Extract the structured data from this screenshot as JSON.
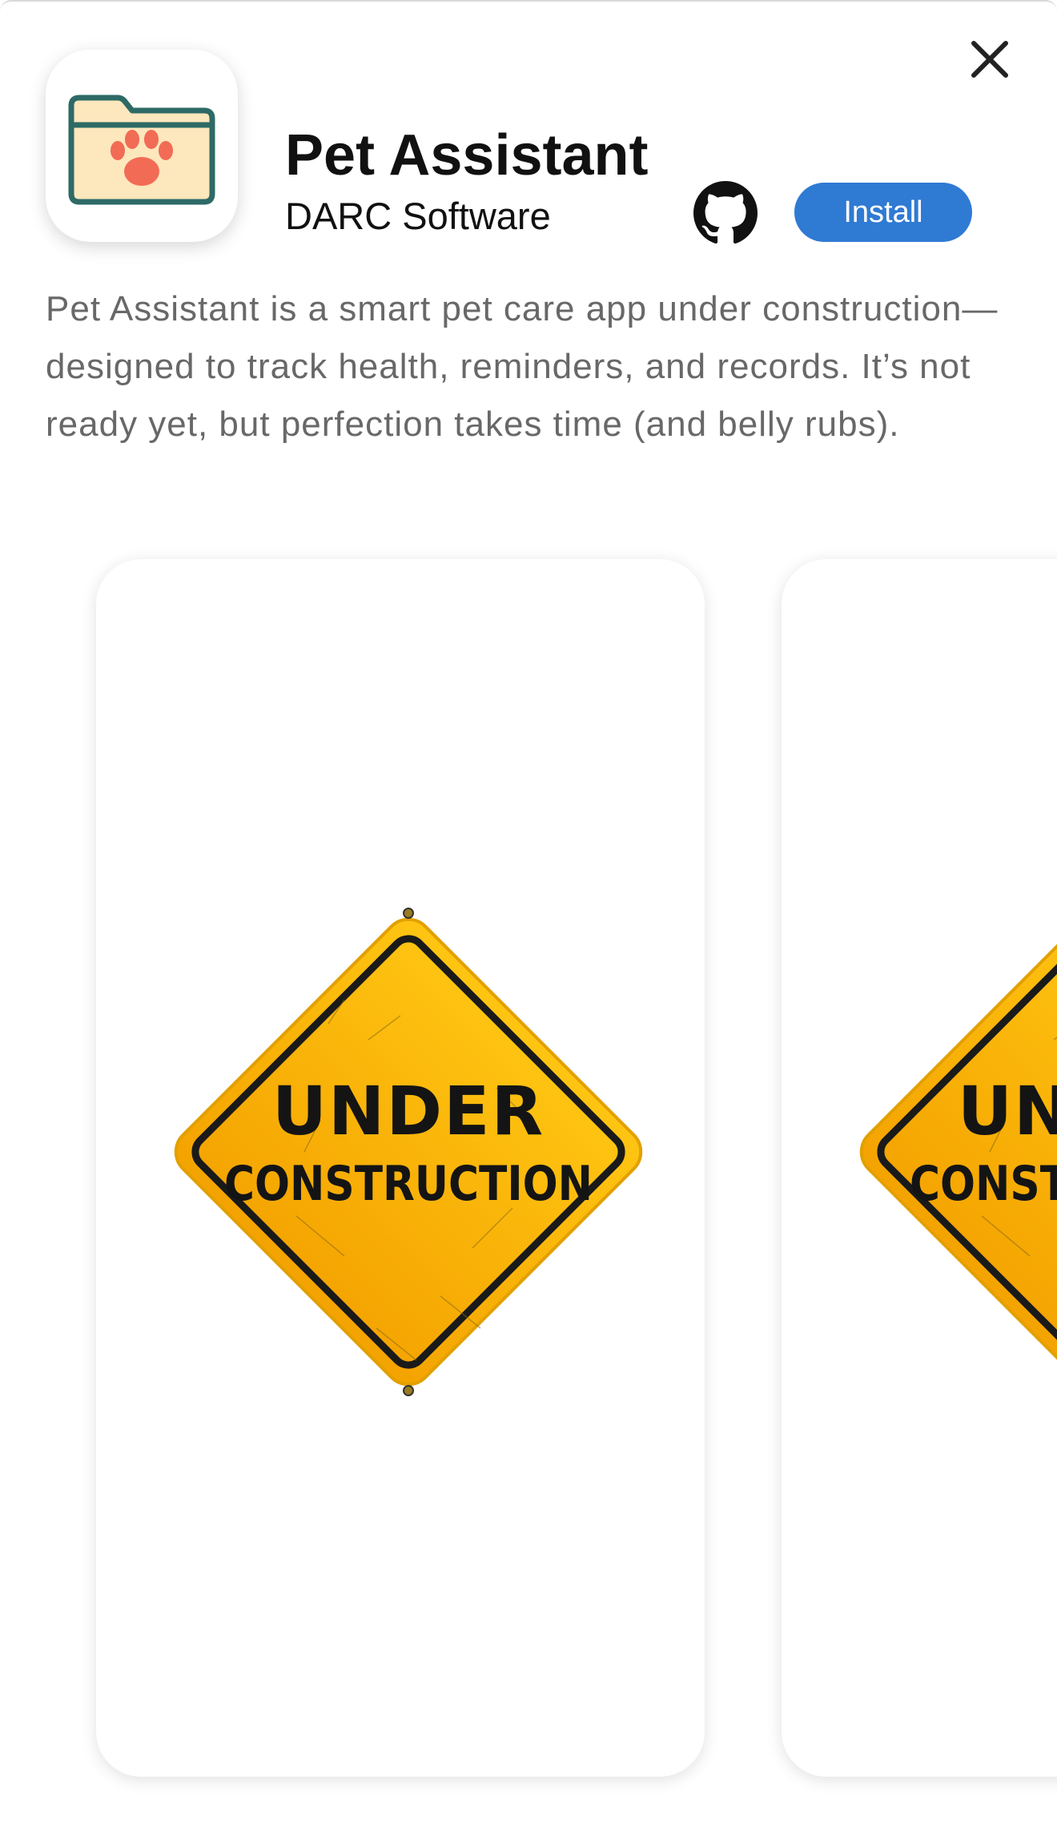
{
  "app": {
    "title": "Pet Assistant",
    "developer": "DARC Software",
    "install_label": "Install",
    "description": "Pet Assistant is a smart pet care app under construction—designed to track health, reminders, and records. It’s not ready yet, but perfection takes time (and belly rubs)."
  },
  "icons": {
    "close": "close-icon",
    "app_icon": "folder-paw-icon",
    "github": "github-icon"
  },
  "screenshots": [
    {
      "sign_line1": "UNDER",
      "sign_line2": "CONSTRUCTION"
    },
    {
      "sign_line1": "UNDER",
      "sign_line2": "CONSTRUCTION"
    }
  ],
  "colors": {
    "install_button": "#2f7ad3",
    "sign_yellow": "#f6b400",
    "paw": "#f26b55",
    "folder_fill": "#fde7bd",
    "folder_stroke": "#2d6a66"
  }
}
